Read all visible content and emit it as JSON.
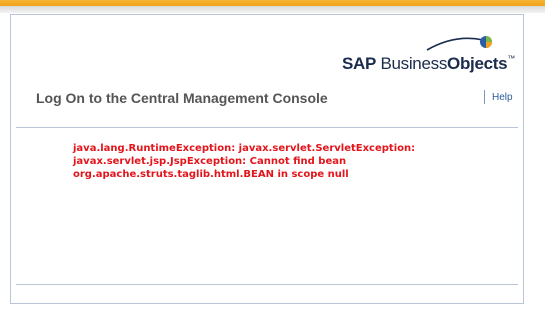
{
  "header": {
    "logo": {
      "brand_sap": "SAP",
      "brand_business": "Business",
      "brand_objects": "Objects",
      "trademark": "™",
      "colors": {
        "swoosh": "#1b2c4d",
        "globe_green": "#7ab648",
        "globe_orange": "#f2a31b",
        "globe_blue": "#2a5ca8"
      }
    },
    "top_bar_color": "#f0a21b"
  },
  "page": {
    "title": "Log On to the Central Management Console",
    "help_label": "Help"
  },
  "error": {
    "lines": [
      "java.lang.RuntimeException: javax.servlet.ServletException:",
      "javax.servlet.jsp.JspException: Cannot find bean",
      "org.apache.struts.taglib.html.BEAN in scope null"
    ],
    "color": "#e4141b"
  }
}
